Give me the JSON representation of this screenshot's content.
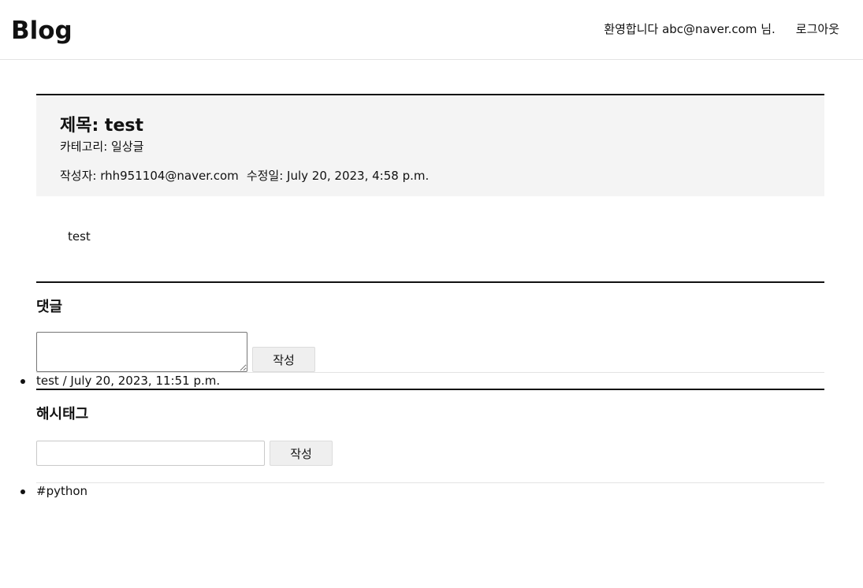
{
  "header": {
    "logo": "Blog",
    "welcome": "환영합니다 abc@naver.com 님.",
    "logout": "로그아웃"
  },
  "post": {
    "title": "제목: test",
    "category": "카테고리: 일상글",
    "author": "작성자: rhh951104@naver.com",
    "modified": "수정일: July 20, 2023, 4:58 p.m.",
    "body": "test"
  },
  "comments": {
    "title": "댓글",
    "textarea_value": "",
    "submit_label": "작성",
    "items": [
      {
        "text": "test / July 20, 2023, 11:51 p.m."
      }
    ]
  },
  "hashtags": {
    "title": "해시태그",
    "input_value": "",
    "submit_label": "작성",
    "items": [
      {
        "text": "#python"
      }
    ]
  }
}
